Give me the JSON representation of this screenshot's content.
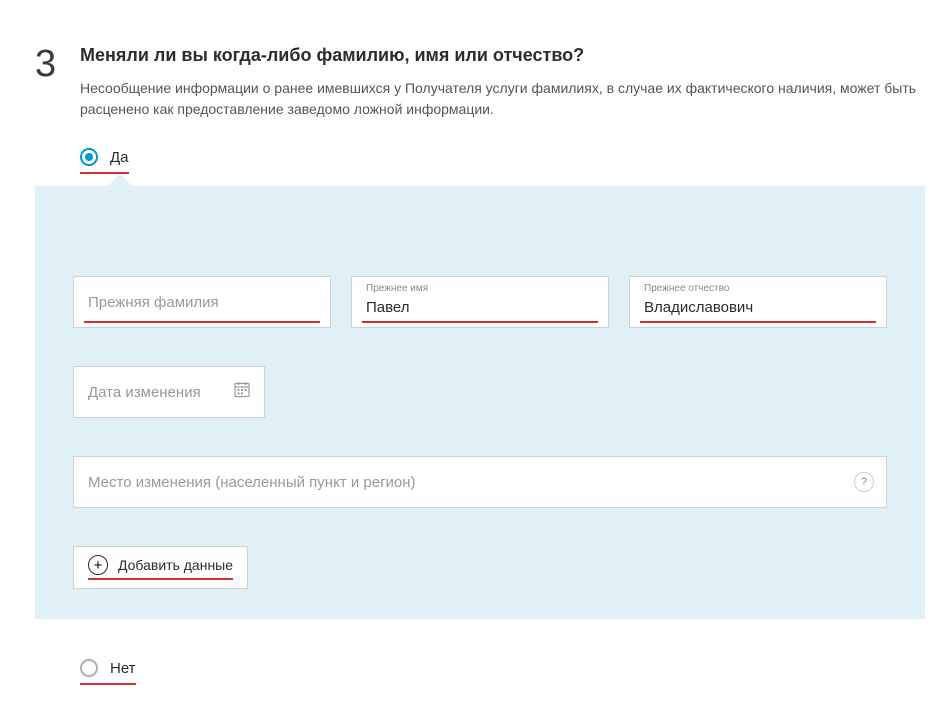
{
  "step": "3",
  "question": {
    "title": "Меняли ли вы когда-либо фамилию, имя или отчество?",
    "description": "Несообщение информации о ранее имевшихся у Получателя услуги фамилиях, в случае их фактического наличия, может быть расценено как предоставление заведомо ложной информации."
  },
  "radio": {
    "yes": "Да",
    "no": "Нет"
  },
  "fields": {
    "prev_surname": {
      "placeholder": "Прежняя фамилия"
    },
    "prev_name": {
      "label": "Прежнее имя",
      "value": "Павел"
    },
    "prev_patronymic": {
      "label": "Прежнее отчество",
      "value": "Владиславович"
    },
    "change_date": {
      "placeholder": "Дата изменения"
    },
    "change_place": {
      "placeholder": "Место изменения (населенный пункт и регион)"
    }
  },
  "add_button": "Добавить данные",
  "help": "?"
}
